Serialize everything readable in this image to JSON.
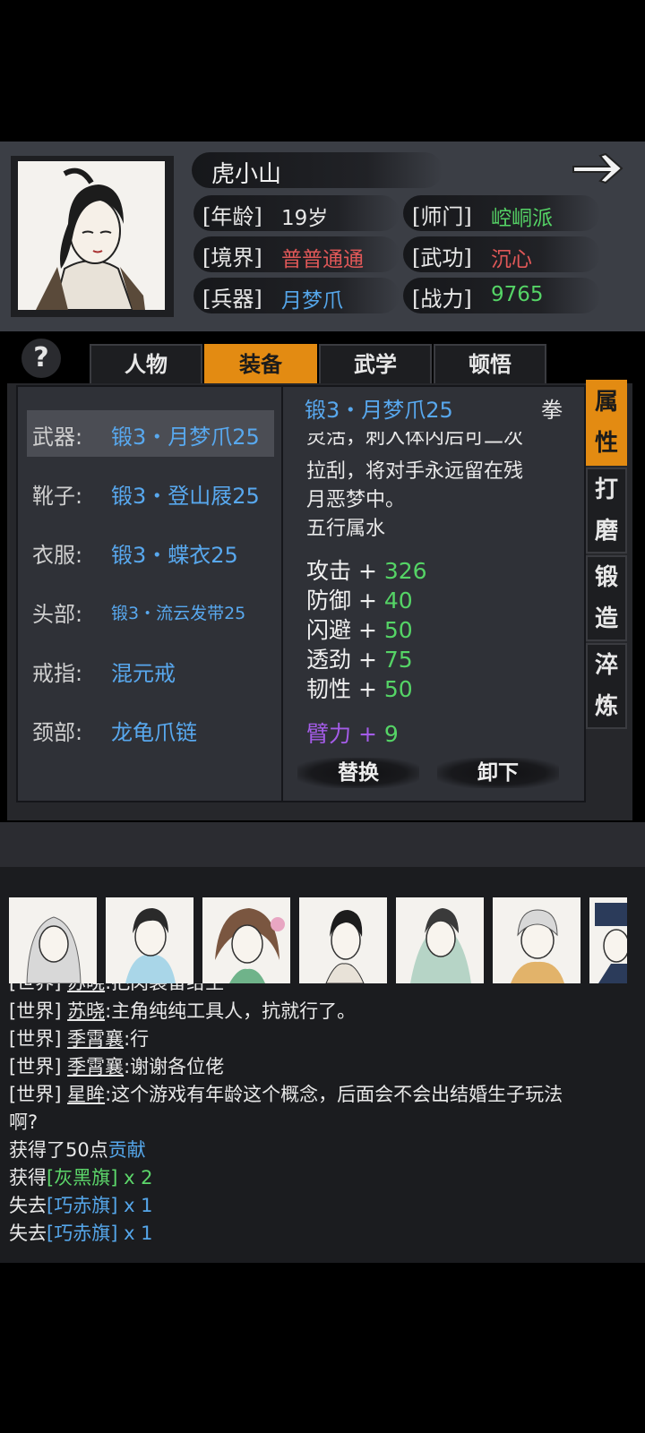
{
  "character": {
    "name": "虎小山",
    "rows": [
      {
        "label": "[年龄]",
        "value": "19岁",
        "color": "#e8e8e8"
      },
      {
        "label": "[师门]",
        "value": "崆峒派",
        "color": "#55d466"
      },
      {
        "label": "[境界]",
        "value": "普普通通",
        "color": "#e05858"
      },
      {
        "label": "[武功]",
        "value": "沉心",
        "color": "#e05858"
      },
      {
        "label": "[兵器]",
        "value": "月梦爪",
        "color": "#55a6ea"
      },
      {
        "label": "[战力]",
        "value": "9765",
        "color": "#55d466"
      }
    ]
  },
  "tabs": {
    "help": "?",
    "items": [
      "人物",
      "装备",
      "武学",
      "顿悟"
    ],
    "active": "装备"
  },
  "equipment": {
    "slots": [
      {
        "label": "武器:",
        "value": "锻3・月梦爪25"
      },
      {
        "label": "靴子:",
        "value": "锻3・登山屐25"
      },
      {
        "label": "衣服:",
        "value": "锻3・蝶衣25"
      },
      {
        "label": "头部:",
        "value": "锻3・流云发带25"
      },
      {
        "label": "戒指:",
        "value": "混元戒"
      },
      {
        "label": "颈部:",
        "value": "龙龟爪链"
      }
    ]
  },
  "detail": {
    "title": "锻3・月梦爪25",
    "type": "拳",
    "desc_partial": "灵活，刺入体内后可二次",
    "desc_lines": [
      "拉刮，将对手永远留在残",
      "月恶梦中。",
      "五行属水"
    ],
    "stats": [
      {
        "name": "攻击",
        "plus": "+",
        "value": "326"
      },
      {
        "name": "防御",
        "plus": "+",
        "value": "40"
      },
      {
        "name": "闪避",
        "plus": "+",
        "value": "50"
      },
      {
        "name": "透劲",
        "plus": "+",
        "value": "75"
      },
      {
        "name": "韧性",
        "plus": "+",
        "value": "50"
      }
    ],
    "bonus": {
      "name": "臂力",
      "plus": "+",
      "value": "9"
    },
    "replace_label": "替换",
    "unequip_label": "卸下"
  },
  "side_tabs": {
    "items": [
      {
        "line1": "属",
        "line2": "性"
      },
      {
        "line1": "打",
        "line2": "磨"
      },
      {
        "line1": "锻",
        "line2": "造"
      },
      {
        "line1": "淬",
        "line2": "炼"
      }
    ],
    "active_index": 0
  },
  "chat": {
    "lines": [
      {
        "channel": "[世界]",
        "user": "苏晓",
        "text": ":把肉装备给主"
      },
      {
        "channel": "[世界]",
        "user": "苏晓",
        "text": ":主角纯纯工具人，抗就行了。"
      },
      {
        "channel": "[世界]",
        "user": "季霄襄",
        "text": ":行"
      },
      {
        "channel": "[世界]",
        "user": "季霄襄",
        "text": ":谢谢各位佬"
      },
      {
        "channel": "[世界]",
        "user": "星眸",
        "text": ":这个游戏有年龄这个概念，后面会不会出结婚生子玩法"
      },
      {
        "channel": "",
        "user": "",
        "text": "啊?"
      }
    ],
    "system": {
      "contribution_prefix": "获得了50点",
      "contribution_link": "贡献",
      "gain_prefix": "获得",
      "gain_item": "[灰黑旗]",
      "gain_count": "x 2",
      "lose1_prefix": "失去",
      "lose1_item": "[巧赤旗]",
      "lose1_count": "x 1",
      "lose2_prefix": "失去",
      "lose2_item": "[巧赤旗]",
      "lose2_count": "x 1"
    }
  },
  "colors": {
    "accent": "#e38b12",
    "blue": "#55a6ea",
    "green": "#55d466",
    "red": "#e05858",
    "purple": "#a45ce8"
  }
}
